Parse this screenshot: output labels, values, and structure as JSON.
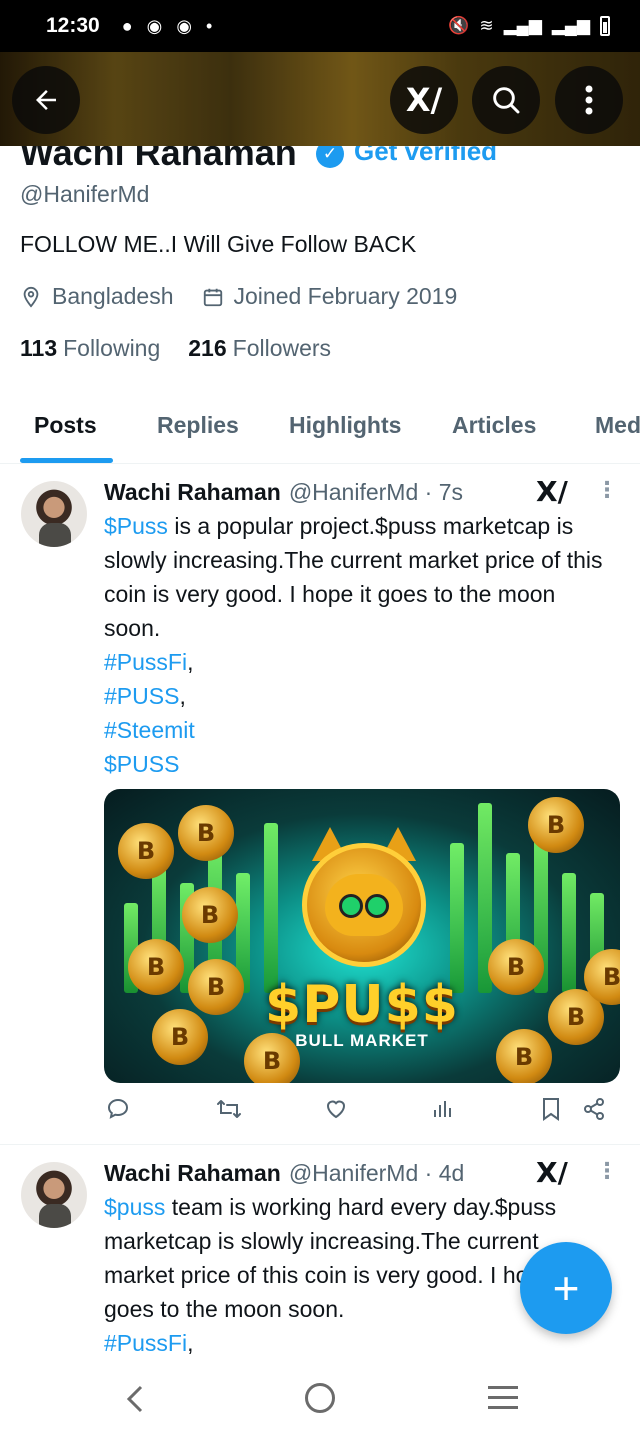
{
  "status_bar": {
    "time": "12:30",
    "dot": "•"
  },
  "header": {
    "back_icon": "arrow-left-icon",
    "grok_label": "X/",
    "search_icon": "search-icon",
    "more_icon": "more-vertical-icon"
  },
  "profile": {
    "name": "Wachi Rahaman",
    "verified_badge": "✓",
    "get_verified": "Get verified",
    "handle": "@HaniferMd",
    "bio": "FOLLOW ME..I Will Give Follow BACK",
    "location": "Bangladesh",
    "joined": "Joined February 2019",
    "following_count": "113",
    "following_label": "Following",
    "followers_count": "216",
    "followers_label": "Followers"
  },
  "tabs": [
    {
      "label": "Posts",
      "active": true
    },
    {
      "label": "Replies"
    },
    {
      "label": "Highlights"
    },
    {
      "label": "Articles"
    },
    {
      "label": "Media"
    }
  ],
  "posts": [
    {
      "name": "Wachi Rahaman",
      "handle_time": "@HaniferMd · 7s",
      "cashtag1": "$Puss",
      "text1": " is a popular project.$puss marketcap is slowly increasing.The current market price of this coin is very good. I hope it goes to the moon soon.",
      "tag1": "#PussFi",
      "tag2": "#PUSS",
      "tag3": "#Steemit",
      "tag4": "$PUSS",
      "comma": ",",
      "image": {
        "title": "$PU$$",
        "subtitle": "BULL MARKET"
      }
    },
    {
      "name": "Wachi Rahaman",
      "handle_time": "@HaniferMd · 4d",
      "cashtag1": "$puss",
      "text1": " team is working hard every day.$puss marketcap is slowly increasing.The current market price of this coin is very good. I hope it goes to the moon soon.",
      "tag1": "#PussFi",
      "comma": ","
    }
  ],
  "fab": {
    "label": "+"
  },
  "colors": {
    "accent": "#1d9bf0",
    "text": "#0f1419",
    "muted": "#536471"
  }
}
